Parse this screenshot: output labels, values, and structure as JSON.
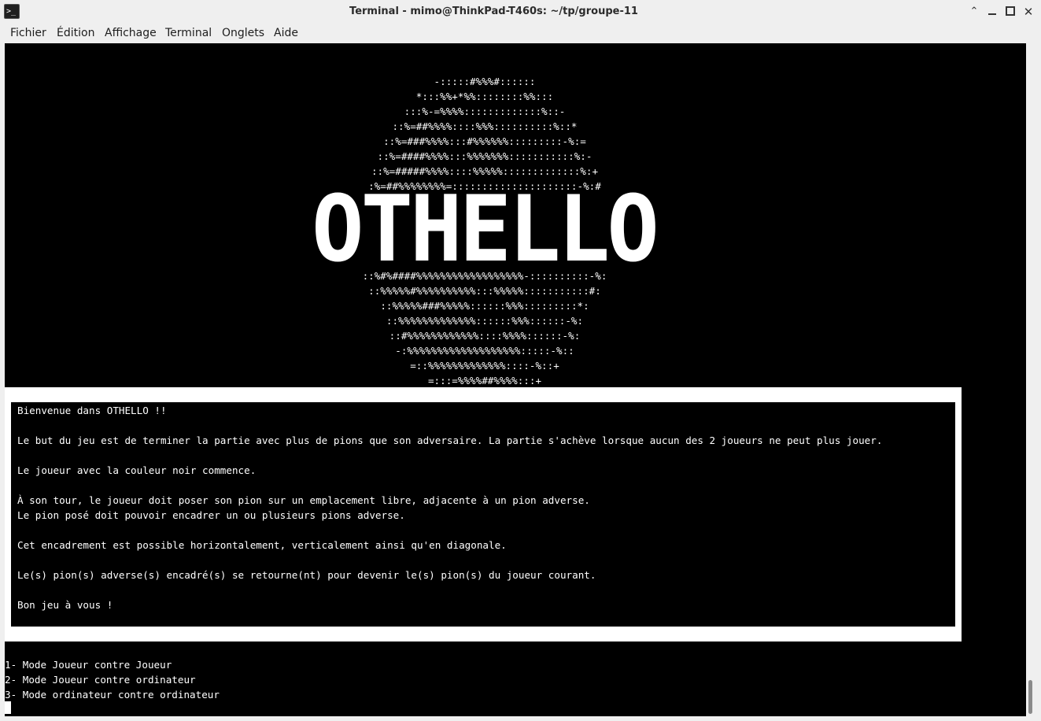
{
  "window": {
    "title": "Terminal - mimo@ThinkPad-T460s: ~/tp/groupe-11",
    "icon": "terminal-icon",
    "icon_glyph": ">_"
  },
  "menubar": {
    "items": [
      "Fichier",
      "Édition",
      "Affichage",
      "Terminal",
      "Onglets",
      "Aide"
    ]
  },
  "terminal": {
    "art_top": [
      "-:::::#%%%#::::::",
      "*:::%%+*%%::::::::%%:::",
      ":::%-=%%%%:::::::::::::%::-",
      "::%=##%%%%::::%%%::::::::::%::*",
      "::%=###%%%%:::#%%%%%%:::::::::-%:=",
      "::%=####%%%%:::%%%%%%%:::::::::::%:-",
      "::%=#####%%%%::::%%%%%:::::::::::::%:+",
      ":%=##%%%%%%%%=:::::::::::::::::::::-%:#"
    ],
    "banner": "OTHELLO",
    "art_bottom": [
      "::%#%####%%%%%%%%%%%%%%%%%%-::::::::::-%:",
      "::%%%%%#%%%%%%%%%%:::%%%%%:::::::::::#:",
      "::%%%%%###%%%%%::::::%%%:::::::::*:",
      "::%%%%%%%%%%%%%::::::%%%::::::-%:",
      "::#%%%%%%%%%%%%::::%%%%::::::-%:",
      "-:%%%%%%%%%%%%%%%%%%%:::::-%::",
      "=::%%%%%%%%%%%%%::::-%::+",
      "=:::=%%%%##%%%%:::+"
    ],
    "info": {
      "welcome": "Bienvenue dans OTHELLO !!",
      "goal": "Le but du jeu est de terminer la partie avec plus de pions que son adversaire. La partie s'achève lorsque aucun des 2 joueurs ne peut plus jouer.",
      "start": "Le joueur avec la couleur noir commence.",
      "turn1": "À son tour, le joueur doit poser son pion sur un emplacement libre, adjacente à un pion adverse.",
      "turn2": "Le pion posé doit pouvoir encadrer un ou plusieurs pions adverse.",
      "frame": "Cet encadrement est possible horizontalement, verticalement ainsi qu'en diagonale.",
      "flip": "Le(s) pion(s) adverse(s) encadré(s) se retourne(nt) pour devenir le(s) pion(s) du joueur courant.",
      "goodluck": "Bon jeu à vous !"
    },
    "modes": [
      "1- Mode Joueur contre Joueur",
      "2- Mode Joueur contre ordinateur",
      "3- Mode ordinateur contre ordinateur"
    ]
  }
}
